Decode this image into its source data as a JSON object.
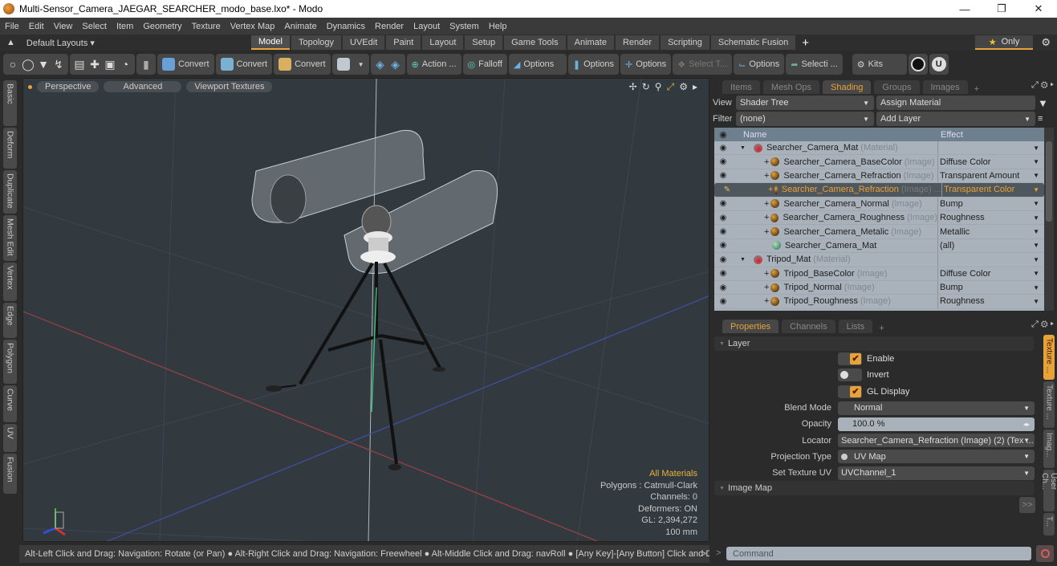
{
  "window": {
    "title": "Multi-Sensor_Camera_JAEGAR_SEARCHER_modo_base.lxo* - Modo",
    "controls": [
      "minimize",
      "restore",
      "close"
    ]
  },
  "menu": [
    "File",
    "Edit",
    "View",
    "Select",
    "Item",
    "Geometry",
    "Texture",
    "Vertex Map",
    "Animate",
    "Dynamics",
    "Render",
    "Layout",
    "System",
    "Help"
  ],
  "layouts": {
    "default_label": "Default Layouts ▾",
    "tabs": [
      "Model",
      "Topology",
      "UVEdit",
      "Paint",
      "Layout",
      "Setup",
      "Game Tools",
      "Animate",
      "Render",
      "Scripting",
      "Schematic Fusion"
    ],
    "active_tab": "Model",
    "only_label": "Only"
  },
  "toolbar": {
    "convert1": "Convert",
    "convert2": "Convert",
    "convert3": "Convert",
    "action": "Action ...",
    "falloff": "Falloff",
    "options1": "Options",
    "options2": "Options",
    "options3": "Options",
    "select_t": "Select T...",
    "options4": "Options",
    "selecti": "Selecti ...",
    "kits": "Kits"
  },
  "left_tabs": [
    "Basic",
    "Deform",
    "Duplicate",
    "Mesh Edit",
    "Vertex",
    "Edge",
    "Polygon",
    "Curve",
    "UV",
    "Fusion"
  ],
  "viewport": {
    "buttons": [
      "Perspective",
      "Advanced",
      "Viewport Textures"
    ],
    "info": {
      "materials": "All Materials",
      "polygons": "Polygons : Catmull-Clark",
      "channels": "Channels: 0",
      "deformers": "Deformers: ON",
      "gl": "GL: 2,394,272",
      "scale": "100 mm"
    }
  },
  "statusbar": "Alt-Left Click and Drag: Navigation: Rotate (or Pan) ● Alt-Right Click and Drag: Navigation: Freewheel ● Alt-Middle Click and Drag: navRoll ● [Any Key]-[Any Button] Click and Drag:",
  "shading_panel": {
    "tabs": [
      "Items",
      "Mesh Ops",
      "Shading",
      "Groups",
      "Images"
    ],
    "active_tab": "Shading",
    "view_label": "View",
    "view_value": "Shader Tree",
    "assign_material": "Assign Material",
    "filter_label": "Filter",
    "filter_value": "(none)",
    "add_layer": "Add Layer",
    "columns": {
      "name": "Name",
      "effect": "Effect"
    },
    "rows": [
      {
        "name": "Searcher_Camera_Mat",
        "type": "(Material)",
        "effect": "",
        "kind": "material",
        "indent": 0
      },
      {
        "name": "Searcher_Camera_BaseColor",
        "type": "(Image)",
        "effect": "Diffuse Color",
        "kind": "image",
        "indent": 1
      },
      {
        "name": "Searcher_Camera_Refraction",
        "type": "(Image)",
        "effect": "Transparent Amount",
        "kind": "image",
        "indent": 1
      },
      {
        "name": "Searcher_Camera_Refraction",
        "type": "(Image) ...",
        "effect": "Transparent Color",
        "kind": "image",
        "indent": 1,
        "selected": true
      },
      {
        "name": "Searcher_Camera_Normal",
        "type": "(Image)",
        "effect": "Bump",
        "kind": "image",
        "indent": 1
      },
      {
        "name": "Searcher_Camera_Roughness",
        "type": "(Image)",
        "effect": "Roughness",
        "kind": "image",
        "indent": 1
      },
      {
        "name": "Searcher_Camera_Metalic",
        "type": "(Image)",
        "effect": "Metallic",
        "kind": "image",
        "indent": 1
      },
      {
        "name": "Searcher_Camera_Mat",
        "type": "",
        "effect": "(all)",
        "kind": "shader",
        "indent": 1
      },
      {
        "name": "Tripod_Mat",
        "type": "(Material)",
        "effect": "",
        "kind": "material",
        "indent": 0
      },
      {
        "name": "Tripod_BaseColor",
        "type": "(Image)",
        "effect": "Diffuse Color",
        "kind": "image",
        "indent": 1
      },
      {
        "name": "Tripod_Normal",
        "type": "(Image)",
        "effect": "Bump",
        "kind": "image",
        "indent": 1
      },
      {
        "name": "Tripod_Roughness",
        "type": "(Image)",
        "effect": "Roughness",
        "kind": "image",
        "indent": 1
      }
    ]
  },
  "properties_panel": {
    "tabs": [
      "Properties",
      "Channels",
      "Lists"
    ],
    "active_tab": "Properties",
    "layer_section": "Layer",
    "enable": {
      "label": "Enable",
      "checked": true
    },
    "invert": {
      "label": "Invert",
      "checked": false
    },
    "gl_display": {
      "label": "GL Display",
      "checked": true
    },
    "blend_mode": {
      "label": "Blend Mode",
      "value": "Normal"
    },
    "opacity": {
      "label": "Opacity",
      "value": "100.0 %"
    },
    "locator": {
      "label": "Locator",
      "value": "Searcher_Camera_Refraction (Image) (2) (Tex ..."
    },
    "projection_type": {
      "label": "Projection Type",
      "value": "UV Map"
    },
    "set_texture_uv": {
      "label": "Set Texture UV",
      "value": "UVChannel_1"
    },
    "image_map_section": "Image Map",
    "more_button": ">>",
    "side_tabs": [
      "Texture ...",
      "Texture ...",
      "Imag...",
      "User Ch...",
      "T..."
    ]
  },
  "command": {
    "placeholder": "Command",
    "prompt": ">"
  }
}
